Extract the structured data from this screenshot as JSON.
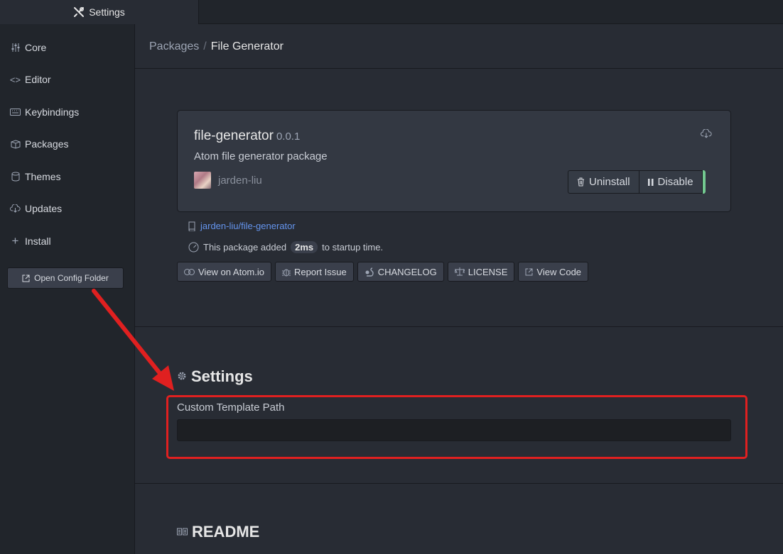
{
  "tab": {
    "icon": "tools-icon",
    "label": "Settings"
  },
  "sidebar": {
    "items": [
      {
        "icon": "sliders-icon",
        "label": "Core"
      },
      {
        "icon": "code-icon",
        "label": "Editor"
      },
      {
        "icon": "keyboard-icon",
        "label": "Keybindings"
      },
      {
        "icon": "package-icon",
        "label": "Packages"
      },
      {
        "icon": "paintcan-icon",
        "label": "Themes"
      },
      {
        "icon": "cloud-download-icon",
        "label": "Updates"
      },
      {
        "icon": "plus-icon",
        "label": "Install"
      }
    ],
    "open_config_label": "Open Config Folder"
  },
  "breadcrumb": {
    "parent": "Packages",
    "separator": "/",
    "current": "File Generator"
  },
  "package": {
    "name": "file-generator",
    "version": "0.0.1",
    "description": "Atom file generator package",
    "author": "jarden-liu",
    "uninstall_label": "Uninstall",
    "disable_label": "Disable",
    "repo_link": "jarden-liu/file-generator",
    "startup_prefix": "This package added",
    "startup_time": "2ms",
    "startup_suffix": "to startup time."
  },
  "link_buttons": {
    "view_atom": "View on Atom.io",
    "report_issue": "Report Issue",
    "changelog": "CHANGELOG",
    "license": "LICENSE",
    "view_code": "View Code"
  },
  "settings": {
    "title": "Settings",
    "custom_template_path_label": "Custom Template Path",
    "custom_template_path_value": ""
  },
  "readme": {
    "title": "README"
  },
  "colors": {
    "background": "#282c34",
    "sidebar": "#21252b",
    "link": "#6494ed",
    "enabled_indicator": "#73c990",
    "annotation": "#e02020"
  }
}
